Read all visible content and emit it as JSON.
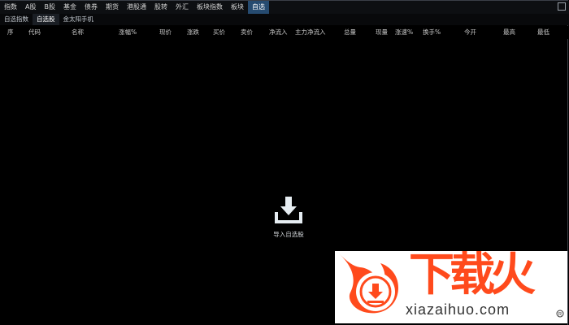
{
  "top_tabs": [
    {
      "label": "指数",
      "active": false
    },
    {
      "label": "A股",
      "active": false
    },
    {
      "label": "B股",
      "active": false
    },
    {
      "label": "基金",
      "active": false
    },
    {
      "label": "债券",
      "active": false
    },
    {
      "label": "期货",
      "active": false
    },
    {
      "label": "港股通",
      "active": false
    },
    {
      "label": "股转",
      "active": false
    },
    {
      "label": "外汇",
      "active": false
    },
    {
      "label": "板块指数",
      "active": false
    },
    {
      "label": "板块",
      "active": false
    },
    {
      "label": "自选",
      "active": true
    }
  ],
  "sub_tabs": [
    {
      "label": "自选指数",
      "active": false
    },
    {
      "label": "自选股",
      "active": true
    },
    {
      "label": "金太阳手机",
      "active": false
    }
  ],
  "table": {
    "columns": [
      "序",
      "代码",
      "名称",
      "涨幅%",
      "现价",
      "涨跌",
      "买价",
      "卖价",
      "净流入",
      "主力净流入",
      "总量",
      "现量",
      "涨速%",
      "换手%",
      "今开",
      "最高",
      "最低"
    ],
    "rows": []
  },
  "empty_state": {
    "label": "导入自选股",
    "icon": "import-download-icon"
  },
  "watermark": {
    "name": "下载火",
    "url": "xiazaihuo.com",
    "accent_color": "#ff4a1c"
  },
  "theme": {
    "background": "#000000",
    "active_tab": "#264b70",
    "text": "#c8c8c8"
  }
}
